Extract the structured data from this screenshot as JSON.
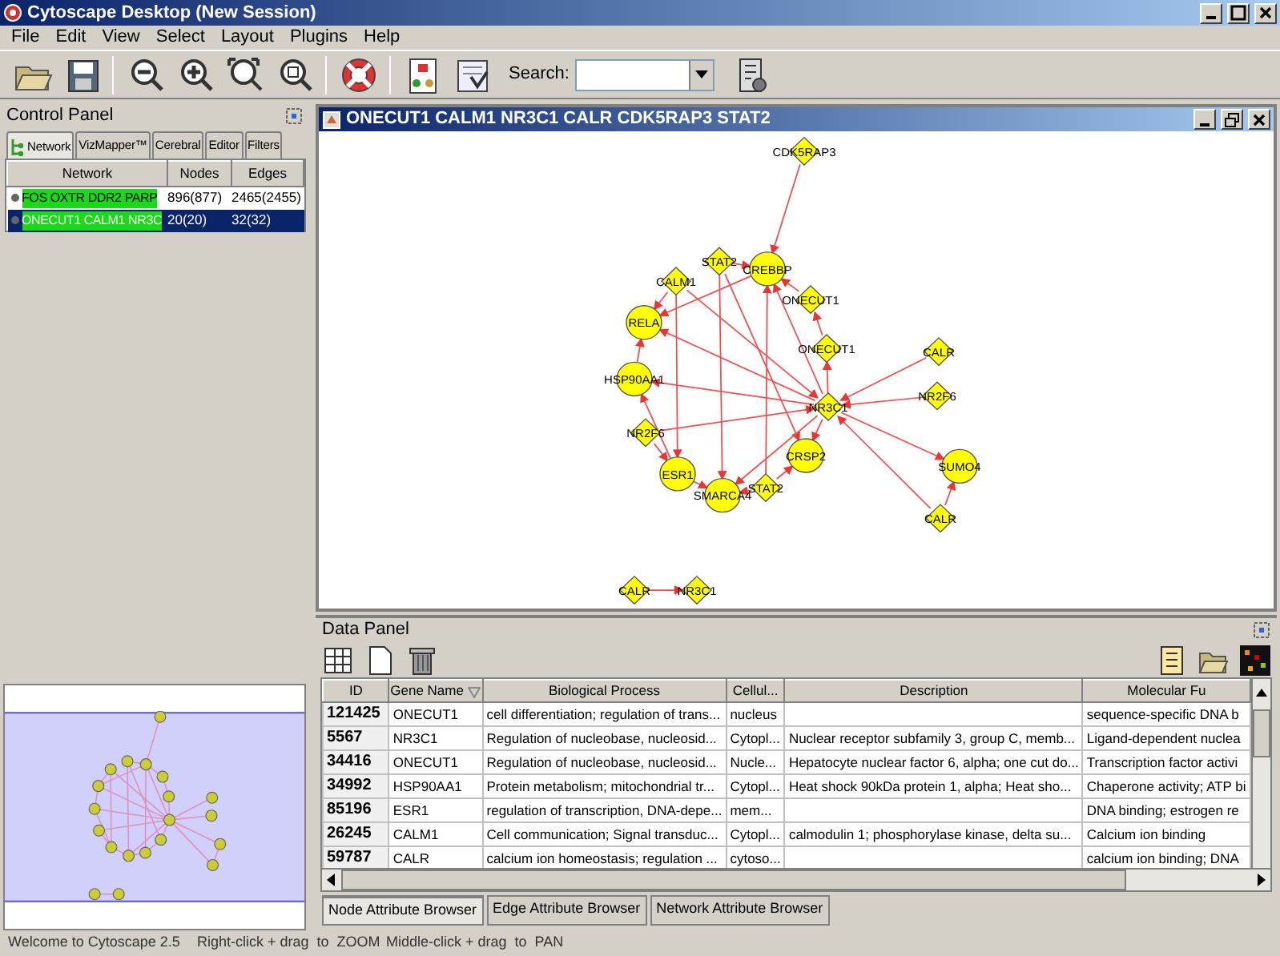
{
  "window": {
    "title": "Cytoscape Desktop (New Session)"
  },
  "menu": [
    "File",
    "Edit",
    "View",
    "Select",
    "Layout",
    "Plugins",
    "Help"
  ],
  "toolbar": {
    "search_label": "Search:"
  },
  "control_panel": {
    "title": "Control Panel",
    "tabs": [
      {
        "label": "Network",
        "selected": true
      },
      {
        "label": "VizMapper™",
        "selected": false
      },
      {
        "label": "Cerebral",
        "selected": false
      },
      {
        "label": "Editor",
        "selected": false
      },
      {
        "label": "Filters",
        "selected": false
      }
    ],
    "network_table": {
      "columns": [
        "Network",
        "Nodes",
        "Edges"
      ],
      "rows": [
        {
          "name": "FOS OXTR DDR2 PARP",
          "nodes": "896(877)",
          "edges": "2465(2455)",
          "selected": false
        },
        {
          "name": "ONECUT1 CALM1 NR3C",
          "nodes": "20(20)",
          "edges": "32(32)",
          "selected": true
        }
      ]
    }
  },
  "network_view": {
    "title": "ONECUT1 CALM1 NR3C1 CALR CDK5RAP3 STAT2",
    "nodes": [
      {
        "label": "CDK5RAP3",
        "kind": "diamond"
      },
      {
        "label": "CREBBP",
        "kind": "circle"
      },
      {
        "label": "STAT2",
        "kind": "diamond"
      },
      {
        "label": "CALM1",
        "kind": "diamond"
      },
      {
        "label": "RELA",
        "kind": "circle"
      },
      {
        "label": "ONECUT1",
        "kind": "diamond"
      },
      {
        "label": "ONECUT1",
        "kind": "diamond"
      },
      {
        "label": "HSP90AA1",
        "kind": "circle"
      },
      {
        "label": "NR3C1",
        "kind": "diamond"
      },
      {
        "label": "CALR",
        "kind": "diamond"
      },
      {
        "label": "NR2F6",
        "kind": "diamond"
      },
      {
        "label": "NR2F6",
        "kind": "diamond"
      },
      {
        "label": "CRSP2",
        "kind": "circle"
      },
      {
        "label": "ESR1",
        "kind": "circle"
      },
      {
        "label": "SMARCA4",
        "kind": "circle"
      },
      {
        "label": "STAT2",
        "kind": "diamond"
      },
      {
        "label": "SUMO4",
        "kind": "circle"
      },
      {
        "label": "CALR",
        "kind": "diamond"
      },
      {
        "label": "CALR",
        "kind": "diamond"
      },
      {
        "label": "NR3C1",
        "kind": "diamond"
      }
    ]
  },
  "data_panel": {
    "title": "Data Panel",
    "columns": [
      "ID",
      "Gene Name",
      "Biological Process",
      "Cellul...",
      "Description",
      "Molecular Fu"
    ],
    "rows": [
      [
        "121425",
        "ONECUT1",
        "cell differentiation; regulation of trans...",
        "nucleus",
        "",
        "sequence-specific DNA b"
      ],
      [
        "5567",
        "NR3C1",
        "Regulation of nucleobase, nucleosid...",
        "Cytopl...",
        "Nuclear receptor subfamily 3, group C, memb...",
        "Ligand-dependent nuclea"
      ],
      [
        "34416",
        "ONECUT1",
        "Regulation of nucleobase, nucleosid...",
        "Nucle...",
        "Hepatocyte nuclear factor 6, alpha; one cut do...",
        "Transcription factor activi"
      ],
      [
        "34992",
        "HSP90AA1",
        "Protein metabolism; mitochondrial tr...",
        "Cytopl...",
        "Heat shock 90kDa protein 1, alpha; Heat sho...",
        "Chaperone activity; ATP bi"
      ],
      [
        "85196",
        "ESR1",
        "regulation of transcription, DNA-depe...",
        "mem...",
        "",
        "DNA binding; estrogen re"
      ],
      [
        "26245",
        "CALM1",
        "Cell communication; Signal transduc...",
        "Cytopl...",
        "calmodulin 1; phosphorylase kinase, delta su...",
        "Calcium ion binding"
      ],
      [
        "59787",
        "CALR",
        "calcium ion homeostasis; regulation ...",
        "cytoso...",
        "",
        "calcium ion binding; DNA"
      ]
    ],
    "tabs": [
      {
        "label": "Node Attribute Browser",
        "selected": true
      },
      {
        "label": "Edge Attribute Browser",
        "selected": false
      },
      {
        "label": "Network Attribute Browser",
        "selected": false
      }
    ]
  },
  "status_bar": [
    "Welcome to Cytoscape 2.5",
    "Right-click + drag  to  ZOOM",
    "Middle-click + drag  to  PAN"
  ]
}
